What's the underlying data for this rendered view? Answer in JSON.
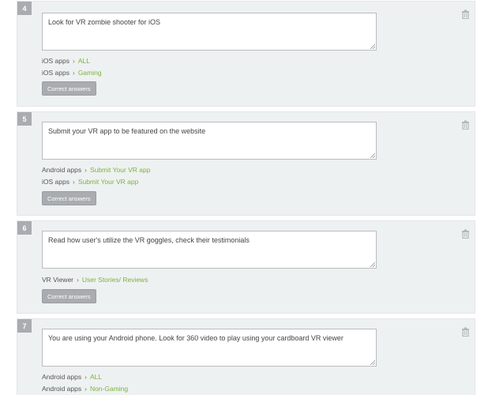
{
  "items": [
    {
      "number": "4",
      "answer_text": "Look for VR zombie shooter for iOS",
      "categories": [
        {
          "parent": "iOS apps",
          "child": "ALL"
        },
        {
          "parent": "iOS apps",
          "child": "Gaming"
        }
      ],
      "button_label": "Correct answers"
    },
    {
      "number": "5",
      "answer_text": "Submit your VR app to be featured on the website",
      "categories": [
        {
          "parent": "Android apps",
          "child": "Submit Your VR app"
        },
        {
          "parent": "iOS apps",
          "child": "Submit Your VR app"
        }
      ],
      "button_label": "Correct answers"
    },
    {
      "number": "6",
      "answer_text": "Read how user's utilize the VR goggles, check their testimonials",
      "categories": [
        {
          "parent": "VR Viewer",
          "child": "User Stories/ Reviews"
        }
      ],
      "button_label": "Correct answers"
    },
    {
      "number": "7",
      "answer_text": "You are using your Android phone. Look for 360 video to play using your cardboard VR viewer",
      "categories": [
        {
          "parent": "Android apps",
          "child": "ALL"
        },
        {
          "parent": "Android apps",
          "child": "Non-Gaming"
        }
      ],
      "button_label": ""
    }
  ],
  "icons": {
    "delete": "trash-icon",
    "separator": "chevron-right-icon"
  },
  "colors": {
    "card_bg": "#eef1f1",
    "badge_bg": "#a9acb0",
    "link_green": "#7cb342",
    "button_bg": "#a9acb0"
  }
}
